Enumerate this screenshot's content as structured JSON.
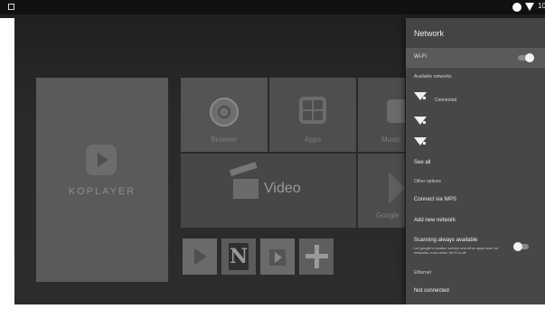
{
  "status_bar": {
    "time": "10"
  },
  "launcher": {
    "app_name": "KOPLAYER",
    "tiles": {
      "browser": "Browser",
      "apps": "Apps",
      "music": "Music",
      "video": "Video",
      "google": "Google"
    },
    "mini_tiles": {
      "netflix_letter": "N"
    }
  },
  "network_panel": {
    "title": "Network",
    "wifi_label": "Wi-Fi",
    "wifi_enabled": true,
    "available_networks_label": "Available networks",
    "networks": [
      {
        "status": "Connected"
      },
      {
        "status": ""
      },
      {
        "status": ""
      }
    ],
    "see_all": "See all",
    "other_options_label": "Other options",
    "connect_via_wps": "Connect via WPS",
    "add_new_network": "Add new network",
    "scanning_title": "Scanning always available",
    "scanning_desc": "Let google's location service and other apps scan for networks, even when Wi-Fi is off",
    "scanning_enabled": false,
    "ethernet_label": "Ethernet",
    "ethernet_status": "Not connected"
  }
}
